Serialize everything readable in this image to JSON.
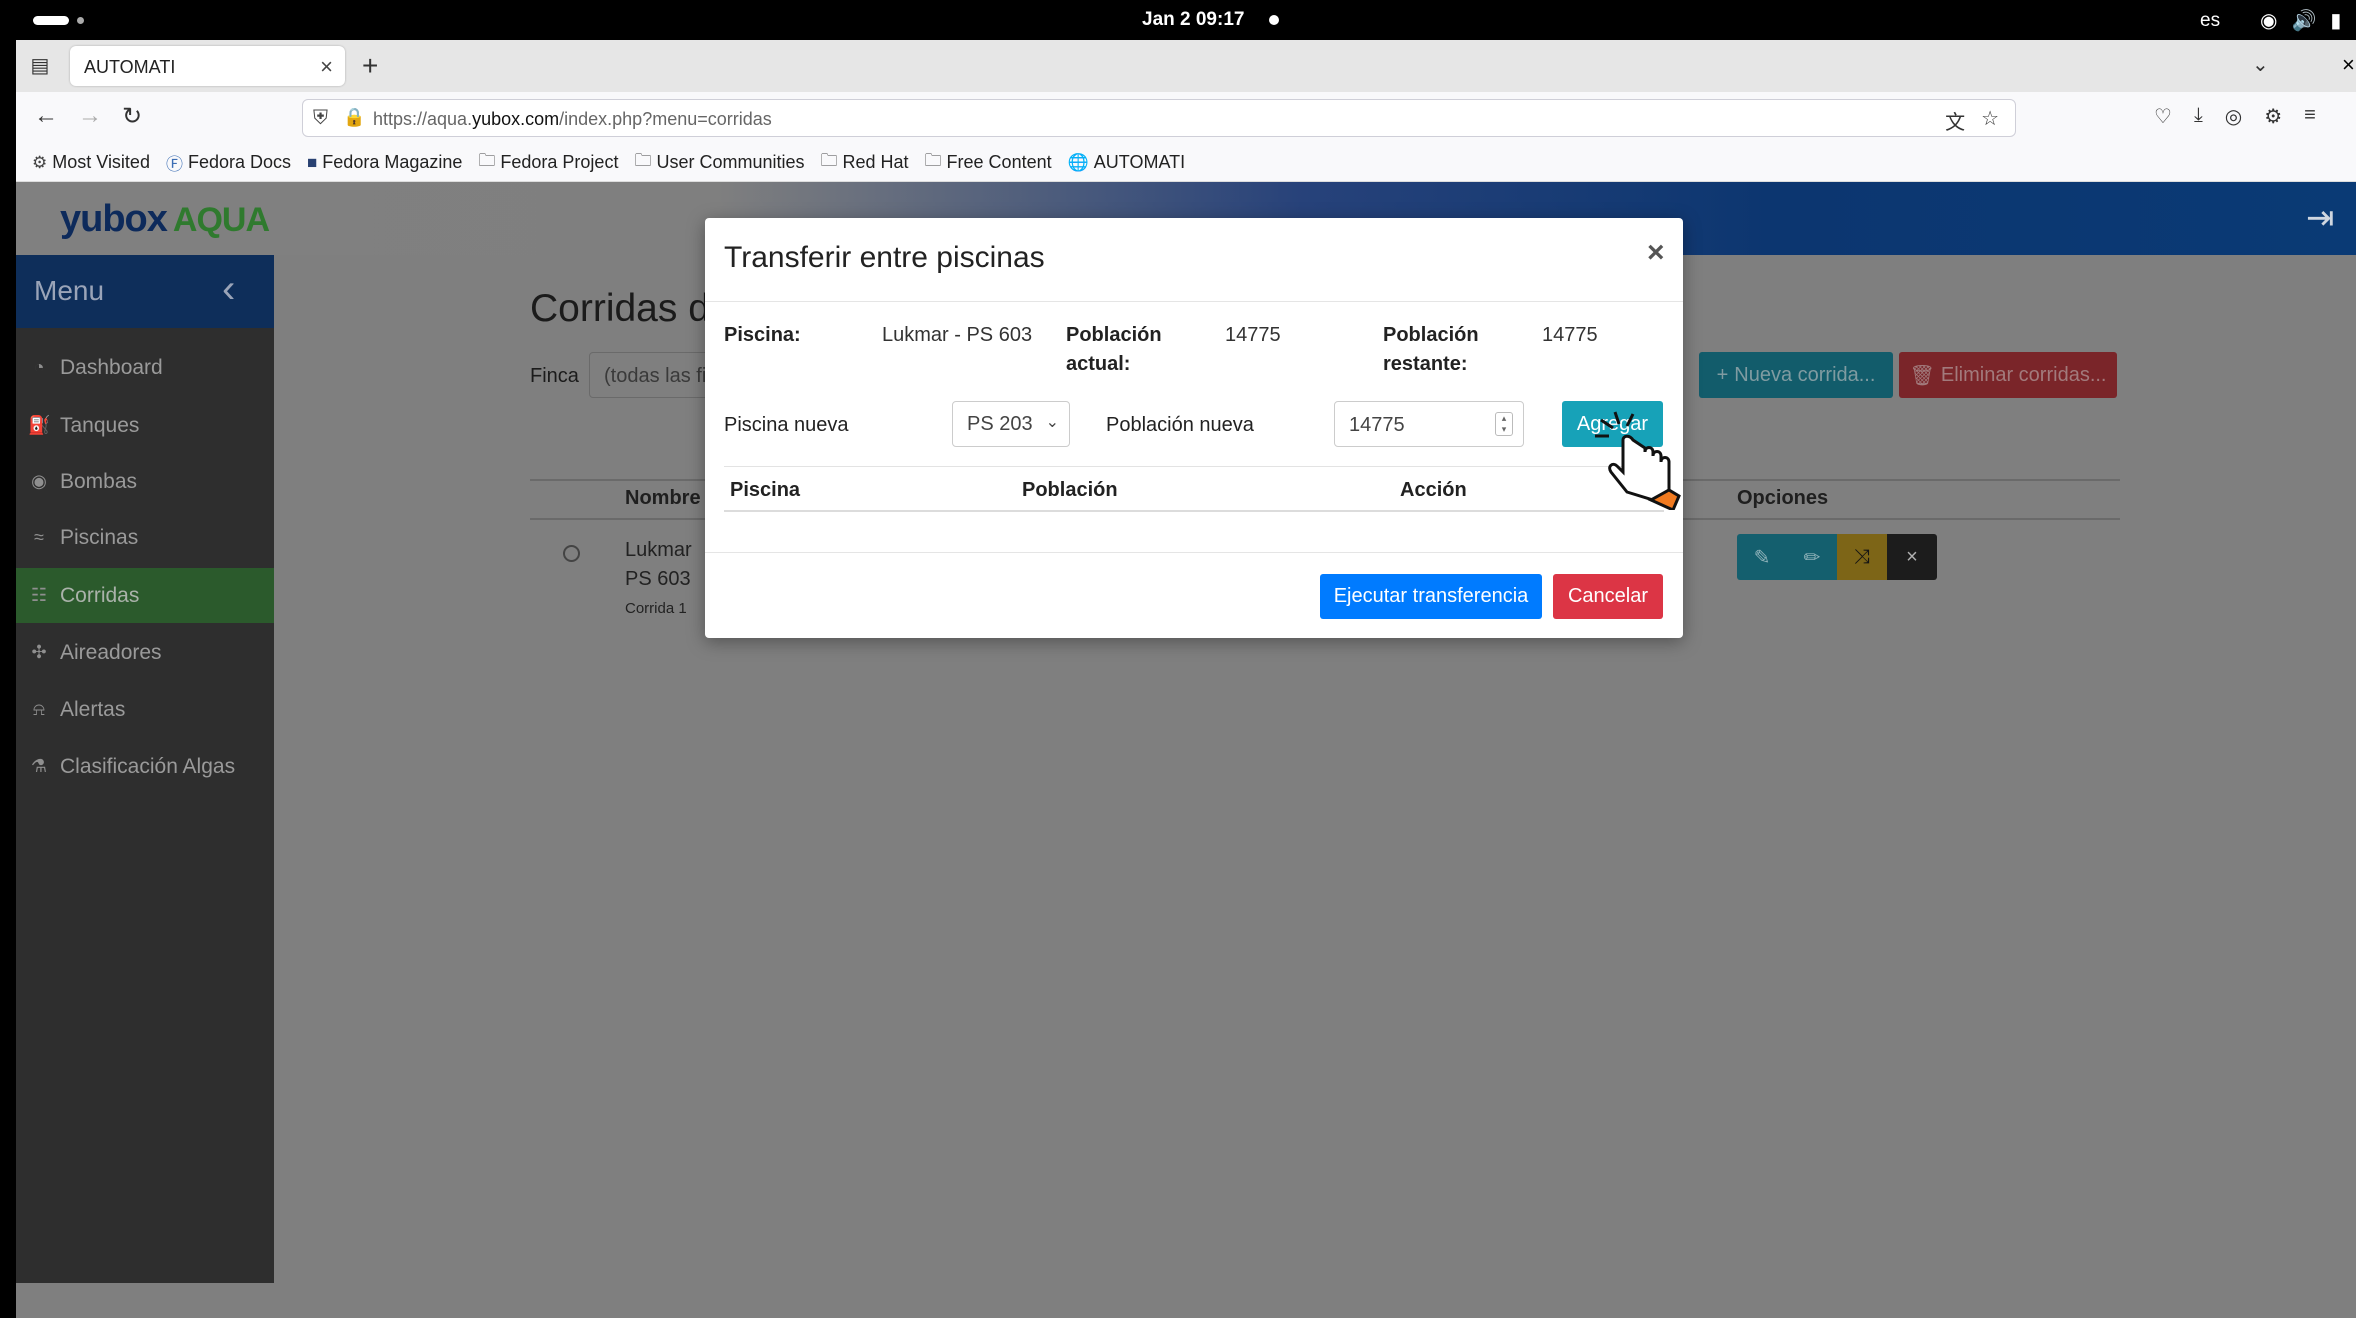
{
  "os": {
    "datetime": "Jan 2  09:17",
    "lang": "es"
  },
  "browser": {
    "tab_title": "AUTOMATI",
    "url_prefix": "https://aqua.",
    "url_domain": "yubox.com",
    "url_path": "/index.php?menu=corridas",
    "bookmarks": [
      "Most Visited",
      "Fedora Docs",
      "Fedora Magazine",
      "Fedora Project",
      "User Communities",
      "Red Hat",
      "Free Content",
      "AUTOMATI"
    ]
  },
  "app": {
    "logo_main": "yubox",
    "logo_accent": "AQUA",
    "menu_label": "Menu",
    "sidebar": [
      {
        "label": "Dashboard",
        "icon": "dashboard-icon"
      },
      {
        "label": "Tanques",
        "icon": "gas-pump-icon"
      },
      {
        "label": "Bombas",
        "icon": "pump-icon"
      },
      {
        "label": "Piscinas",
        "icon": "water-icon"
      },
      {
        "label": "Corridas",
        "icon": "fish-icon",
        "active": true
      },
      {
        "label": "Aireadores",
        "icon": "fan-icon"
      },
      {
        "label": "Alertas",
        "icon": "bell-icon"
      },
      {
        "label": "Clasificación Algas",
        "icon": "microscope-icon"
      }
    ]
  },
  "main": {
    "title": "Corridas d",
    "finca_label": "Finca",
    "finca_value": "(todas las fi",
    "nueva_button": "Nueva corrida...",
    "eliminar_button": "Eliminar corridas...",
    "col_nombre": "Nombre",
    "col_opciones": "Opciones",
    "row": {
      "line1": "Lukmar",
      "line2": "PS 603",
      "line3": "Corrida 1"
    }
  },
  "modal": {
    "title": "Transferir entre piscinas",
    "close": "×",
    "piscina_label": "Piscina:",
    "piscina_value": "Lukmar - PS 603",
    "pob_actual_label_1": "Población",
    "pob_actual_label_2": "actual:",
    "pob_actual_value": "14775",
    "pob_restante_label_1": "Población",
    "pob_restante_label_2": "restante:",
    "pob_restante_value": "14775",
    "piscina_nueva_label": "Piscina nueva",
    "piscina_nueva_value": "PS 203",
    "pob_nueva_label": "Población nueva",
    "pob_nueva_value": "14775",
    "agregar_button": "Agregar",
    "table_headers": [
      "Piscina",
      "Población",
      "Acción"
    ],
    "ejecutar_button": "Ejecutar transferencia",
    "cancelar_button": "Cancelar"
  }
}
